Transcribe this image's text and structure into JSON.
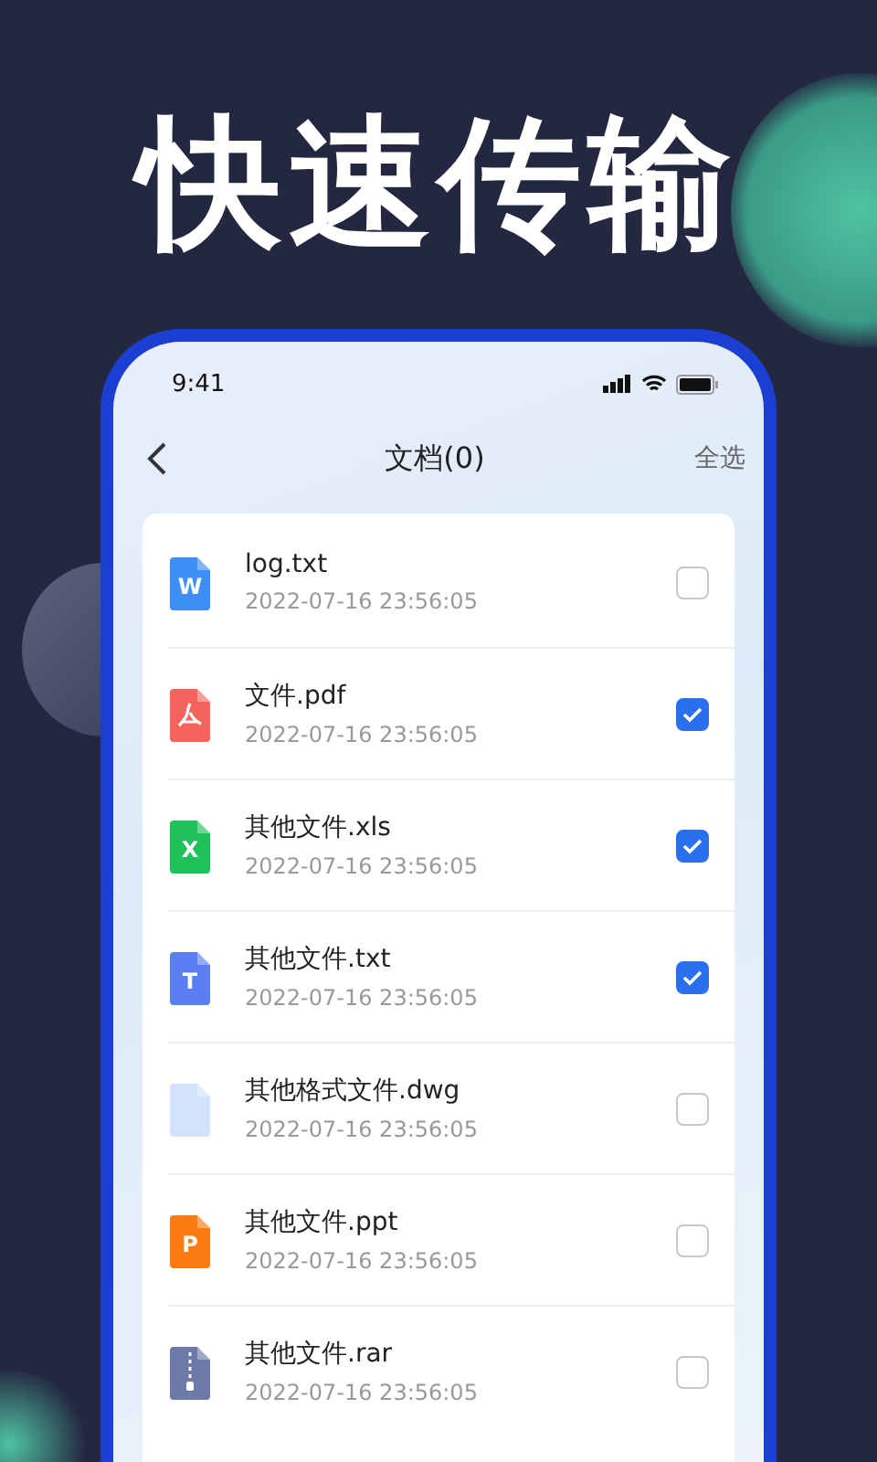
{
  "headline": "快速传输",
  "status_bar": {
    "time": "9:41"
  },
  "nav": {
    "title": "文档(0)",
    "action": "全选"
  },
  "files": [
    {
      "kind": "word",
      "glyph": "W",
      "name": "log.txt",
      "date": "2022-07-16  23:56:05",
      "checked": false
    },
    {
      "kind": "pdf",
      "name": "文件.pdf",
      "date": "2022-07-16  23:56:05",
      "checked": true
    },
    {
      "kind": "excel",
      "glyph": "X",
      "name": "其他文件.xls",
      "date": "2022-07-16  23:56:05",
      "checked": true
    },
    {
      "kind": "text",
      "glyph": "T",
      "name": "其他文件.txt",
      "date": "2022-07-16  23:56:05",
      "checked": true
    },
    {
      "kind": "blank",
      "name": "其他格式文件.dwg",
      "date": "2022-07-16  23:56:05",
      "checked": false
    },
    {
      "kind": "ppt",
      "glyph": "P",
      "name": "其他文件.ppt",
      "date": "2022-07-16  23:56:05",
      "checked": false
    },
    {
      "kind": "zip",
      "name": "其他文件.rar",
      "date": "2022-07-16  23:56:05",
      "checked": false
    }
  ]
}
